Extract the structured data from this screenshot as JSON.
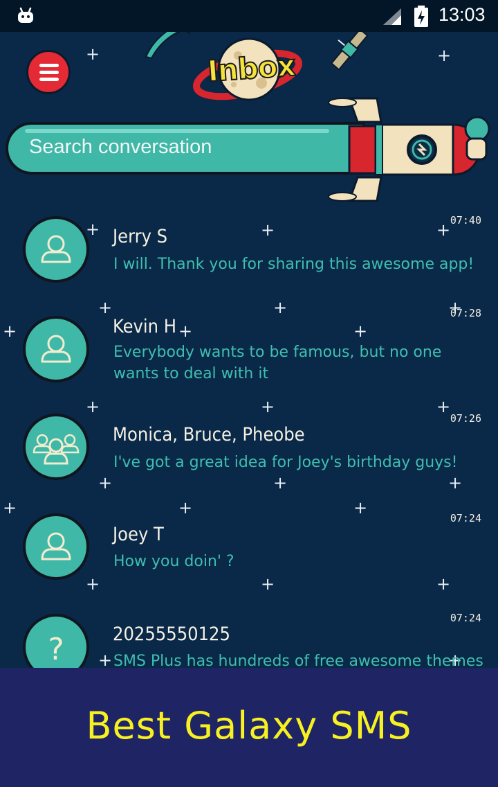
{
  "status_bar": {
    "time": "13:03",
    "icons": [
      "android-icon",
      "signal-icon",
      "battery-charging-icon"
    ]
  },
  "header": {
    "logo_text": "Inbox",
    "menu_icon": "hamburger-menu-icon"
  },
  "search": {
    "placeholder": "Search conversation",
    "icon": "search-icon"
  },
  "conversations": [
    {
      "name": "Jerry S",
      "preview": "I will. Thank you for sharing this awesome app!",
      "time": "07:40",
      "avatar": "person-icon"
    },
    {
      "name": "Kevin H",
      "preview": "Everybody wants to be famous, but no one wants to deal with it",
      "time": "07:28",
      "avatar": "person-icon"
    },
    {
      "name": "Monica, Bruce, Pheobe",
      "preview": "I've got a great idea for Joey's birthday guys!",
      "time": "07:26",
      "avatar": "group-icon"
    },
    {
      "name": "Joey T",
      "preview": "How you doin' ?",
      "time": "07:24",
      "avatar": "person-icon"
    },
    {
      "name": "20255550125",
      "preview": "SMS Plus has hundreds of free awesome themes",
      "time": "07:24",
      "avatar": "unknown-contact-icon"
    }
  ],
  "banner": {
    "title": "Best Galaxy SMS"
  },
  "colors": {
    "background": "#0a2847",
    "accent": "#3fb8a8",
    "menu_button": "#e32a35",
    "banner": "#1f2465",
    "banner_text": "#f8f121"
  }
}
